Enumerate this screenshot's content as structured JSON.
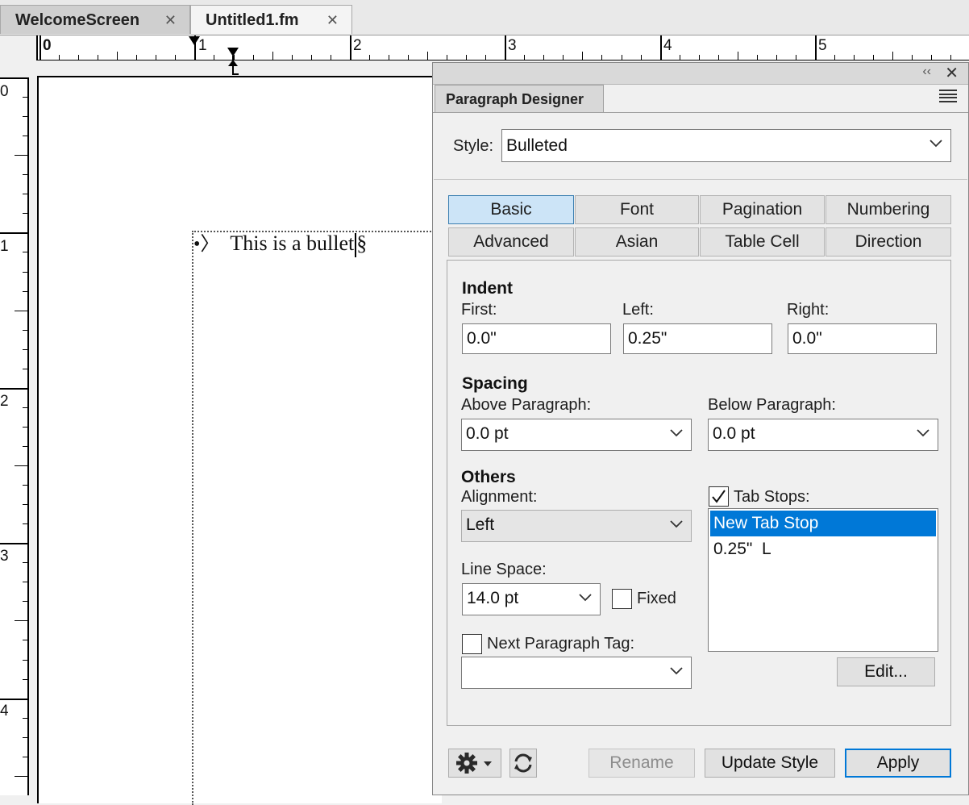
{
  "tabs": [
    {
      "label": "WelcomeScreen",
      "close": "✕"
    },
    {
      "label": "Untitled1.fm",
      "close": "✕"
    }
  ],
  "ruler": {
    "horizontal": [
      "0",
      "1",
      "2",
      "3",
      "4",
      "5"
    ],
    "vertical": [
      "0",
      "1",
      "2",
      "3",
      "4"
    ]
  },
  "document": {
    "bullet": "•〉",
    "text": "This is a bullet",
    "end_mark": "§"
  },
  "panel": {
    "title": "Paragraph Designer",
    "collapse": "‹‹",
    "close": "✕",
    "style_label": "Style:",
    "style_value": "Bulleted",
    "tabs": [
      "Basic",
      "Font",
      "Pagination",
      "Numbering",
      "Advanced",
      "Asian",
      "Table Cell",
      "Direction"
    ],
    "selected_tab": "Basic",
    "indent": {
      "heading": "Indent",
      "first_label": "First:",
      "first_value": "0.0\"",
      "left_label": "Left:",
      "left_value": "0.25\"",
      "right_label": "Right:",
      "right_value": "0.0\""
    },
    "spacing": {
      "heading": "Spacing",
      "above_label": "Above Paragraph:",
      "above_value": "0.0 pt",
      "below_label": "Below Paragraph:",
      "below_value": "0.0 pt"
    },
    "others": {
      "heading": "Others",
      "alignment_label": "Alignment:",
      "alignment_value": "Left",
      "line_space_label": "Line Space:",
      "line_space_value": "14.0 pt",
      "fixed_label": "Fixed",
      "fixed_checked": false,
      "next_tag_label": "Next Paragraph Tag:",
      "next_tag_checked": false,
      "next_tag_value": ""
    },
    "tab_stops": {
      "label": "Tab Stops:",
      "checked": true,
      "items": [
        "New Tab Stop",
        "0.25\"  L"
      ],
      "edit_label": "Edit..."
    },
    "footer": {
      "rename": "Rename",
      "update_style": "Update Style",
      "apply": "Apply"
    }
  }
}
